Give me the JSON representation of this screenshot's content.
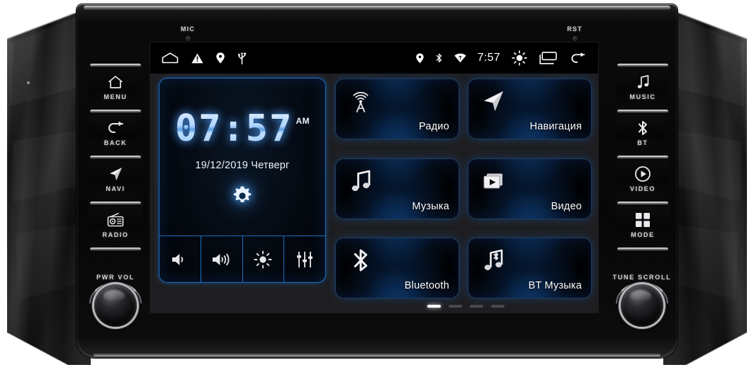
{
  "device": {
    "sensors": [
      {
        "label": "MIC",
        "name": "mic-hole"
      },
      {
        "label": "RST",
        "name": "reset-hole"
      }
    ],
    "left_buttons": [
      {
        "label": "MENU",
        "icon": "home-icon"
      },
      {
        "label": "BACK",
        "icon": "back-arrow-icon"
      },
      {
        "label": "NAVI",
        "icon": "navigation-arrow-icon"
      },
      {
        "label": "RADIO",
        "icon": "radio-icon"
      }
    ],
    "right_buttons": [
      {
        "label": "MUSIC",
        "icon": "music-note-icon"
      },
      {
        "label": "BT",
        "icon": "bluetooth-icon"
      },
      {
        "label": "VIDEO",
        "icon": "play-circle-icon"
      },
      {
        "label": "MODE",
        "icon": "grid-squares-icon"
      }
    ],
    "left_knob": {
      "label": "PWR  VOL"
    },
    "right_knob": {
      "label": "TUNE  SCROLL"
    }
  },
  "statusbar": {
    "left_icons": [
      {
        "name": "home-icon"
      },
      {
        "name": "warning-triangle-icon"
      },
      {
        "name": "location-pin-icon"
      },
      {
        "name": "usb-icon"
      }
    ],
    "right_icons": [
      {
        "name": "location-pin-icon"
      },
      {
        "name": "bluetooth-icon"
      },
      {
        "name": "wifi-icon"
      }
    ],
    "time": "7:57",
    "trailing_icons": [
      {
        "name": "brightness-icon"
      },
      {
        "name": "recent-apps-icon"
      },
      {
        "name": "back-arrow-icon"
      }
    ]
  },
  "clock_widget": {
    "time": "07:57",
    "meridiem": "AM",
    "date": "19/12/2019  Четверг",
    "settings_icon": "gear-icon",
    "controls": [
      {
        "name": "volume-down-icon"
      },
      {
        "name": "volume-up-icon"
      },
      {
        "name": "brightness-icon"
      },
      {
        "name": "equalizer-icon"
      }
    ]
  },
  "tiles": [
    {
      "label": "Радио",
      "icon": "radio-tower-icon"
    },
    {
      "label": "Навигация",
      "icon": "navigation-arrow-icon"
    },
    {
      "label": "Музыка",
      "icon": "music-note-icon"
    },
    {
      "label": "Видео",
      "icon": "video-play-icon"
    },
    {
      "label": "Bluetooth",
      "icon": "bluetooth-icon"
    },
    {
      "label": "BT Музыка",
      "icon": "bluetooth-music-icon"
    }
  ],
  "pager": {
    "count": 4,
    "active": 0
  },
  "colors": {
    "accent_blue": "#1b6fc4",
    "screen_bg": "#1e1e20",
    "statusbar_bg": "#000000",
    "clock_digit": "#cfe3ff",
    "label_white": "#ffffff"
  }
}
